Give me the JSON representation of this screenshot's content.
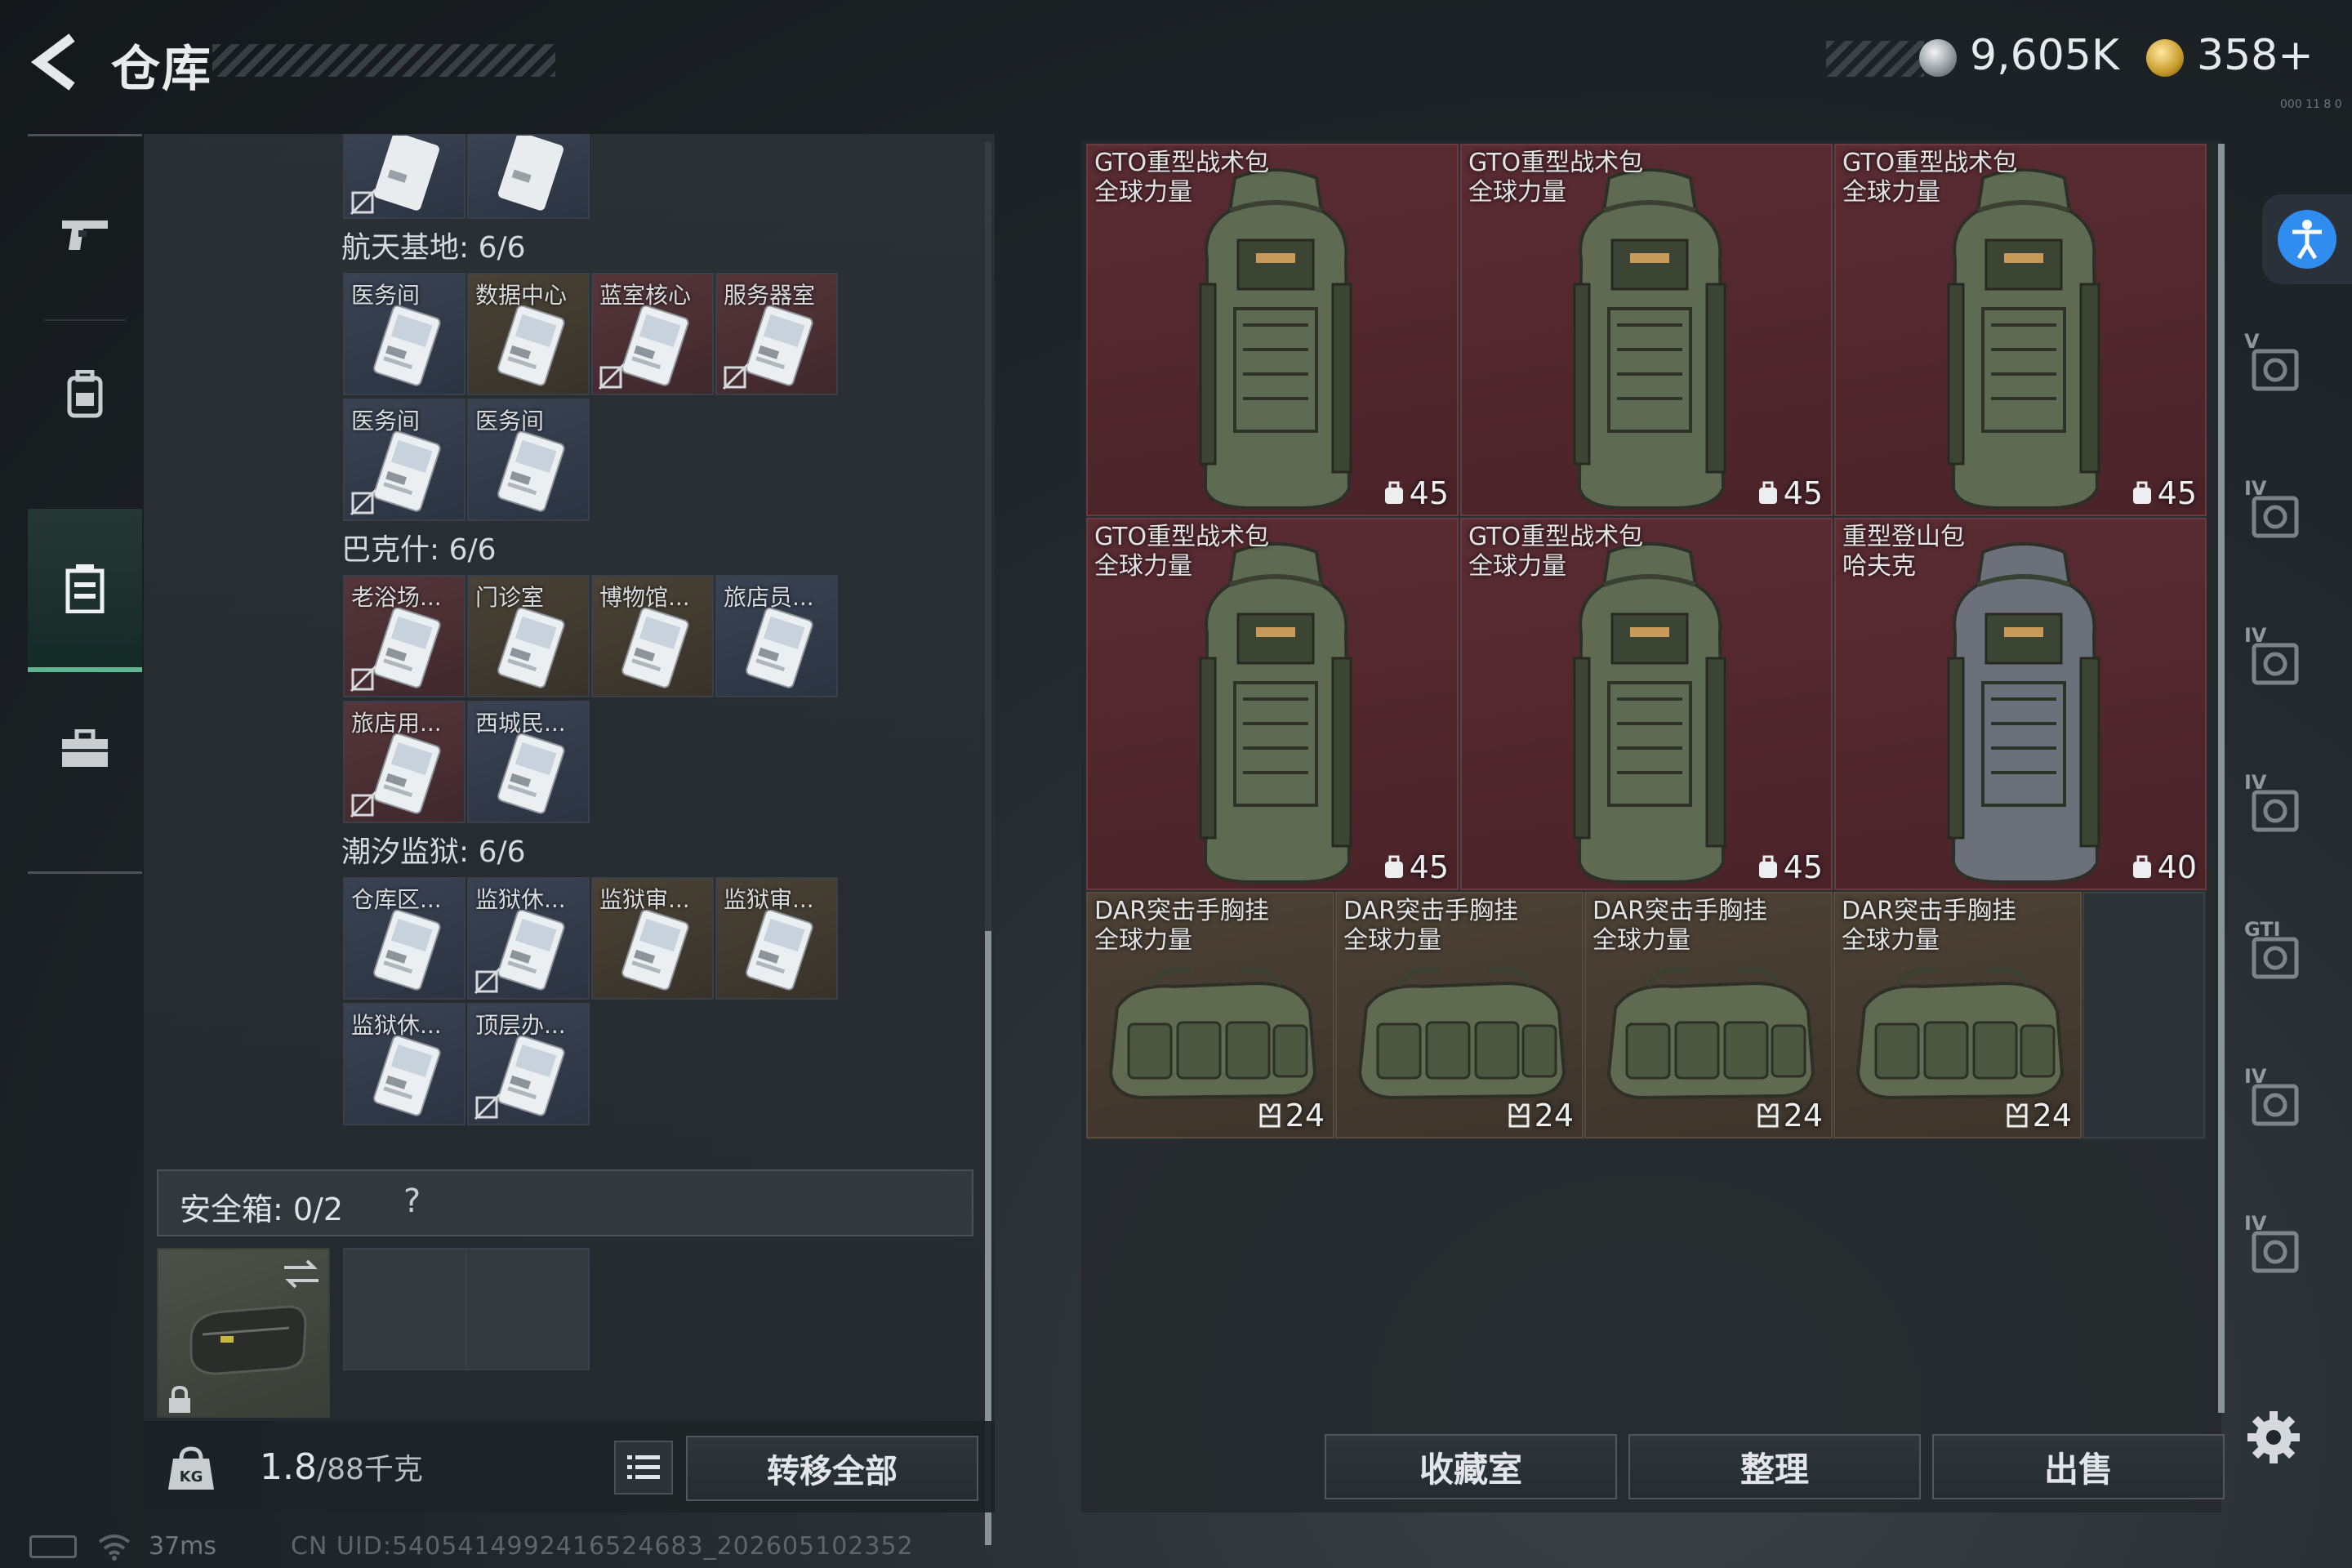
{
  "header": {
    "title": "仓库",
    "currency_silver": "9,605K",
    "currency_gold": "358+",
    "tiny_text": "000 11 8 0"
  },
  "left_nav": {
    "items": [
      {
        "icon": "pistol-icon"
      },
      {
        "icon": "backpack-icon"
      },
      {
        "icon": "storage-bin-icon",
        "active": true
      },
      {
        "icon": "toolbox-icon"
      }
    ]
  },
  "storage": {
    "sections": [
      {
        "title": "航天基地: 6/6",
        "items": [
          {
            "label": "医务间",
            "tint": "blue",
            "nosell": false
          },
          {
            "label": "数据中心",
            "tint": "brown",
            "nosell": false
          },
          {
            "label": "蓝室核心",
            "tint": "red",
            "nosell": true
          },
          {
            "label": "服务器室",
            "tint": "red",
            "nosell": true
          },
          {
            "label": "医务间",
            "tint": "blue",
            "nosell": true
          },
          {
            "label": "医务间",
            "tint": "blue",
            "nosell": false
          }
        ]
      },
      {
        "title": "巴克什: 6/6",
        "items": [
          {
            "label": "老浴场...",
            "tint": "red",
            "nosell": true
          },
          {
            "label": "门诊室",
            "tint": "brown",
            "nosell": false
          },
          {
            "label": "博物馆...",
            "tint": "brown",
            "nosell": false
          },
          {
            "label": "旅店员...",
            "tint": "blue",
            "nosell": false
          },
          {
            "label": "旅店用...",
            "tint": "red",
            "nosell": true
          },
          {
            "label": "西城民...",
            "tint": "blue",
            "nosell": false
          }
        ]
      },
      {
        "title": "潮汐监狱: 6/6",
        "items": [
          {
            "label": "仓库区...",
            "tint": "blue",
            "nosell": false
          },
          {
            "label": "监狱休...",
            "tint": "blue",
            "nosell": true
          },
          {
            "label": "监狱审...",
            "tint": "brown",
            "nosell": false
          },
          {
            "label": "监狱审...",
            "tint": "brown",
            "nosell": false
          },
          {
            "label": "监狱休...",
            "tint": "blue",
            "nosell": false
          },
          {
            "label": "顶层办...",
            "tint": "blue",
            "nosell": true
          }
        ]
      }
    ],
    "safebox_label": "安全箱: 0/2",
    "safebox_help": "?",
    "weight_current": "1.8",
    "weight_capacity": "/88千克",
    "transfer_all": "转移全部"
  },
  "backpacks": {
    "large": [
      {
        "name_line1": "GTO重型战术包",
        "name_line2": "全球力量",
        "capacity": "45",
        "color": "#5e6b52"
      },
      {
        "name_line1": "GTO重型战术包",
        "name_line2": "全球力量",
        "capacity": "45",
        "color": "#5e6b52"
      },
      {
        "name_line1": "GTO重型战术包",
        "name_line2": "全球力量",
        "capacity": "45",
        "color": "#5e6b52"
      },
      {
        "name_line1": "GTO重型战术包",
        "name_line2": "全球力量",
        "capacity": "45",
        "color": "#5e6b52"
      },
      {
        "name_line1": "GTO重型战术包",
        "name_line2": "全球力量",
        "capacity": "45",
        "color": "#5e6b52"
      },
      {
        "name_line1": "重型登山包",
        "name_line2": "哈夫克",
        "capacity": "40",
        "color": "#6c707a"
      }
    ],
    "vests": [
      {
        "name_line1": "DAR突击手胸挂",
        "name_line2": "全球力量",
        "capacity": "24"
      },
      {
        "name_line1": "DAR突击手胸挂",
        "name_line2": "全球力量",
        "capacity": "24"
      },
      {
        "name_line1": "DAR突击手胸挂",
        "name_line2": "全球力量",
        "capacity": "24"
      },
      {
        "name_line1": "DAR突击手胸挂",
        "name_line2": "全球力量",
        "capacity": "24"
      }
    ]
  },
  "actions": {
    "collection": "收藏室",
    "sort": "整理",
    "sell": "出售"
  },
  "right_rail": [
    {
      "icon": "helmet-slot-icon",
      "tier": "V"
    },
    {
      "icon": "armor-slot-icon",
      "tier": "IV"
    },
    {
      "icon": "folder-slot-icon",
      "tier": "IV"
    },
    {
      "icon": "medkit-slot-icon",
      "tier": "IV"
    },
    {
      "icon": "gti-slot-icon",
      "tier": "GTI"
    },
    {
      "icon": "vest-slot-icon",
      "tier": "IV"
    },
    {
      "icon": "bag-slot-icon",
      "tier": "IV"
    }
  ],
  "status": {
    "ping": "37ms",
    "uid": "CN UID:5405414992416524683_202605102352"
  }
}
